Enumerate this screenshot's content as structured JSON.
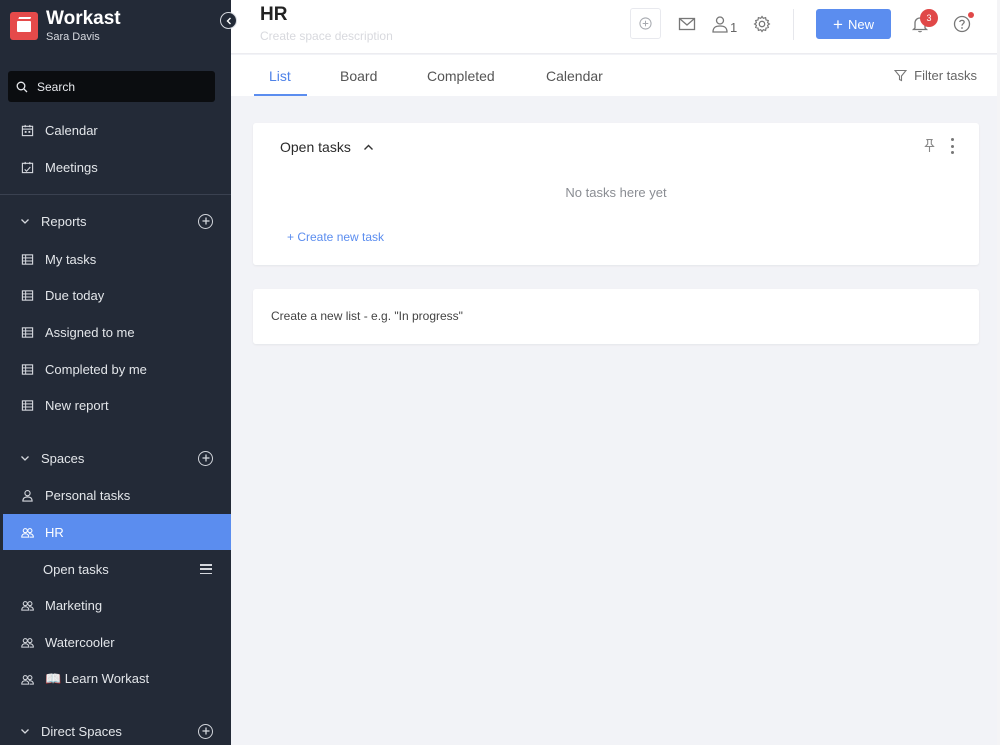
{
  "app": {
    "name": "Workast",
    "user": "Sara Davis"
  },
  "sidebar": {
    "search_label": "Search",
    "top_items": [
      {
        "label": "Calendar",
        "icon": "calendar-icon"
      },
      {
        "label": "Meetings",
        "icon": "meetings-icon"
      }
    ],
    "reports": {
      "label": "Reports",
      "items": [
        {
          "label": "My tasks",
          "icon": "table-icon"
        },
        {
          "label": "Due today",
          "icon": "table-icon"
        },
        {
          "label": "Assigned to me",
          "icon": "table-icon"
        },
        {
          "label": "Completed by me",
          "icon": "table-icon"
        },
        {
          "label": "New report",
          "icon": "table-icon"
        }
      ]
    },
    "spaces": {
      "label": "Spaces",
      "items": [
        {
          "label": "Personal tasks",
          "icon": "person-icon"
        },
        {
          "label": "HR",
          "icon": "people-icon",
          "active": true
        },
        {
          "label": "Open tasks",
          "sub": true
        },
        {
          "label": "Marketing",
          "icon": "people-icon"
        },
        {
          "label": "Watercooler",
          "icon": "people-icon"
        },
        {
          "label": "📖 Learn Workast",
          "icon": "people-icon"
        }
      ]
    },
    "direct_spaces": {
      "label": "Direct Spaces"
    }
  },
  "header": {
    "title": "HR",
    "description_placeholder": "Create space description",
    "member_count": "1",
    "new_button": "New",
    "notification_count": "3"
  },
  "tabs": [
    {
      "label": "List",
      "active": true
    },
    {
      "label": "Board"
    },
    {
      "label": "Completed"
    },
    {
      "label": "Calendar"
    }
  ],
  "filter_label": "Filter tasks",
  "list": {
    "title": "Open tasks",
    "empty_text": "No tasks here yet",
    "create_task": "+ Create new task"
  },
  "new_list_placeholder": "Create a new list - e.g. \"In progress\"",
  "colors": {
    "accent": "#5b8def",
    "sidebar_bg": "#232a37",
    "badge": "#e04848"
  }
}
